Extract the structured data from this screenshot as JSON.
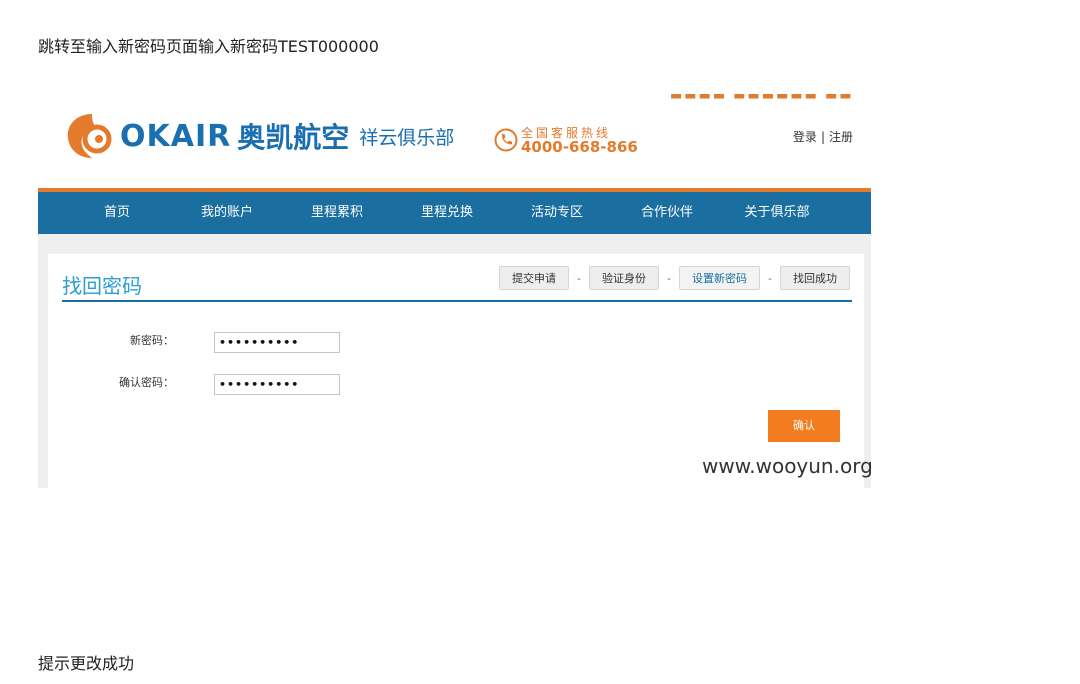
{
  "captions": {
    "top": "跳转至输入新密码页面输入新密码TEST000000",
    "bottom": "提示更改成功"
  },
  "site": {
    "logo_en": "OKAIR",
    "logo_cn": "奥凯航空",
    "logo_sub": "祥云俱乐部",
    "hotline_label": "全国客服热线",
    "hotline_number": "4000-668-866",
    "login": "登录",
    "separator": "|",
    "register": "注册",
    "nav": [
      "首页",
      "我的账户",
      "里程累积",
      "里程兑换",
      "活动专区",
      "合作伙伴",
      "关于俱乐部"
    ]
  },
  "panel": {
    "title": "找回密码",
    "steps": [
      "提交申请",
      "验证身份",
      "设置新密码",
      "找回成功"
    ],
    "step_separator": "-",
    "active_step": 2,
    "fields": {
      "new_password_label": "新密码：",
      "new_password_value": "••••••••••",
      "confirm_password_label": "确认密码：",
      "confirm_password_value": "••••••••••"
    },
    "confirm_button": "确认",
    "watermark": "www.wooyun.org"
  },
  "colors": {
    "brand_blue": "#1b6ea0",
    "accent_orange": "#e47a2b",
    "title_blue": "#2a9fd6",
    "button_orange": "#f47c20"
  }
}
